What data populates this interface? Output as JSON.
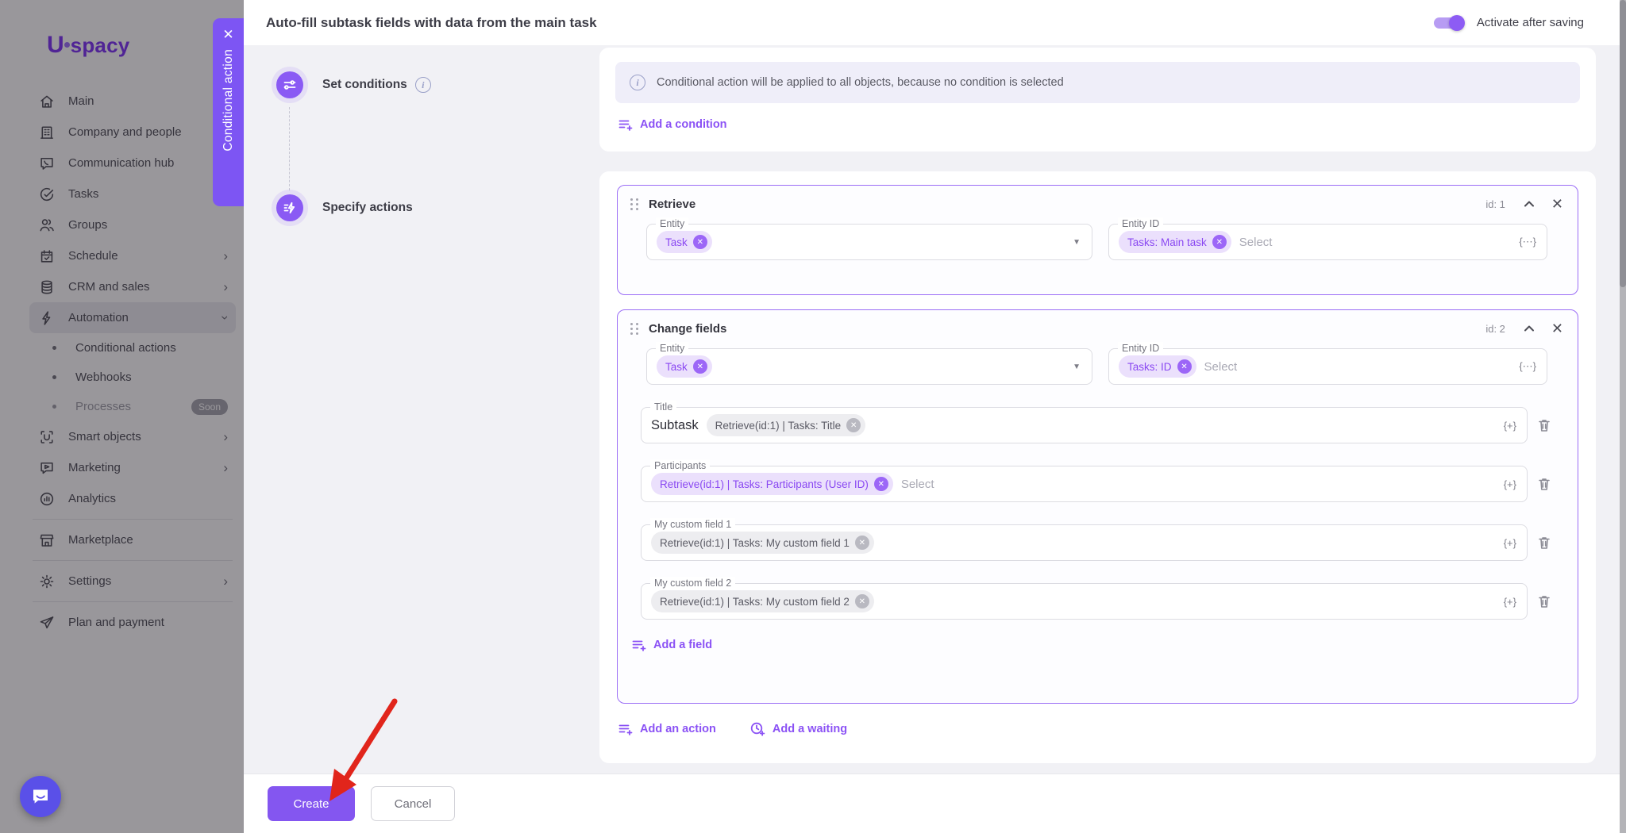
{
  "sidebar": {
    "logo_u": "U",
    "logo_rest": "spacy",
    "items": [
      {
        "key": "main",
        "label": "Main",
        "icon": "home"
      },
      {
        "key": "company-and-people",
        "label": "Company and people",
        "icon": "building"
      },
      {
        "key": "communication-hub",
        "label": "Communication hub",
        "icon": "chat"
      },
      {
        "key": "tasks",
        "label": "Tasks",
        "icon": "check-circle"
      },
      {
        "key": "groups",
        "label": "Groups",
        "icon": "people"
      },
      {
        "key": "schedule",
        "label": "Schedule",
        "icon": "calendar",
        "chevron": "right"
      },
      {
        "key": "crm-and-sales",
        "label": "CRM and sales",
        "icon": "layers",
        "chevron": "right"
      },
      {
        "key": "automation",
        "label": "Automation",
        "icon": "bolt",
        "chevron": "down",
        "active": true
      },
      {
        "key": "conditional-actions",
        "label": "Conditional actions",
        "sub": true
      },
      {
        "key": "webhooks",
        "label": "Webhooks",
        "sub": true
      },
      {
        "key": "processes",
        "label": "Processes",
        "sub": true,
        "badge": "Soon",
        "disabled": true
      },
      {
        "key": "smart-objects",
        "label": "Smart objects",
        "icon": "smart",
        "chevron": "right"
      },
      {
        "key": "marketing",
        "label": "Marketing",
        "icon": "megaphone",
        "chevron": "right"
      },
      {
        "key": "analytics",
        "label": "Analytics",
        "icon": "analytics"
      },
      {
        "key": "marketplace",
        "label": "Marketplace",
        "icon": "store",
        "divider_before": true
      },
      {
        "key": "settings",
        "label": "Settings",
        "icon": "gear",
        "chevron": "right",
        "divider_before": true
      },
      {
        "key": "plan-and-payment",
        "label": "Plan and payment",
        "icon": "plane",
        "divider_before": true
      }
    ]
  },
  "drawer_tab": {
    "label": "Conditional action",
    "close_glyph": "✕"
  },
  "modal": {
    "title": "Auto-fill subtask fields with data from the main task",
    "toggle_label": "Activate after saving",
    "steps": [
      {
        "label": "Set conditions"
      },
      {
        "label": "Specify actions"
      }
    ],
    "conditions": {
      "banner_text": "Conditional action will be applied to all objects, because no condition is selected",
      "add_condition_label": "Add a condition"
    },
    "actions": {
      "card1": {
        "title": "Retrieve",
        "id_label": "id: 1",
        "entity_label": "Entity",
        "entity_chip": "Task",
        "entity_id_label": "Entity ID",
        "entity_id_chip": "Tasks: Main task",
        "select_placeholder": "Select"
      },
      "card2": {
        "title": "Change fields",
        "id_label": "id: 2",
        "entity_label": "Entity",
        "entity_chip": "Task",
        "entity_id_label": "Entity ID",
        "entity_id_chip": "Tasks: ID",
        "select_placeholder": "Select",
        "fields": [
          {
            "key": "title",
            "label": "Title",
            "prefix_text": "Subtask",
            "chip": "Retrieve(id:1) | Tasks: Title",
            "chip_style": "gray"
          },
          {
            "key": "participants",
            "label": "Participants",
            "chip": "Retrieve(id:1) | Tasks: Participants (User ID)",
            "chip_style": "purple",
            "placeholder": "Select"
          },
          {
            "key": "my-custom-field-1",
            "label": "My custom field 1",
            "chip": "Retrieve(id:1) | Tasks: My custom field 1",
            "chip_style": "gray"
          },
          {
            "key": "my-custom-field-2",
            "label": "My custom field 2",
            "chip": "Retrieve(id:1) | Tasks: My custom field 2",
            "chip_style": "gray"
          }
        ],
        "add_field_label": "Add a field"
      },
      "add_action_label": "Add an action",
      "add_waiting_label": "Add a waiting"
    },
    "footer": {
      "create_label": "Create",
      "cancel_label": "Cancel"
    }
  },
  "icons": {
    "info_glyph": "i",
    "chip_remove_glyph": "✕",
    "insert_variable_glyph": "{+}",
    "expression_glyph": "{⋯}",
    "dropdown_caret_glyph": "▼",
    "chevron_glyph": "›"
  },
  "colors": {
    "accent_purple": "#7d55f3",
    "chip_purple_bg": "#ebe0fc",
    "chip_purple_text": "#8a48f2",
    "card_border": "#9b6df6",
    "body_gray": "#f1f1f5",
    "annotation_red": "#e1251b",
    "chat_fab_blue": "#5a50e8"
  }
}
